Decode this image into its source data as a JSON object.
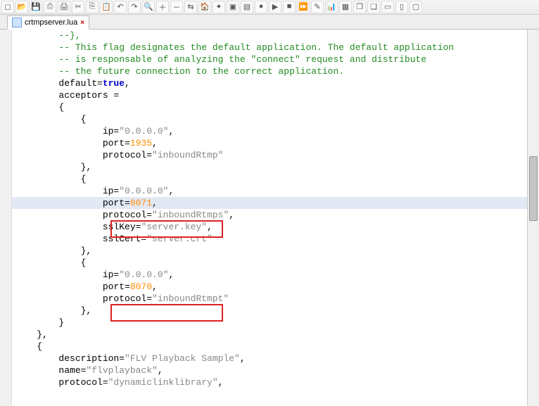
{
  "toolbar_icons": [
    "new",
    "open",
    "save",
    "saveall",
    "sep",
    "cut",
    "copy",
    "paste",
    "sep",
    "undo",
    "redo",
    "search",
    "replace",
    "zoom",
    "zoom-out",
    "home",
    "up",
    "down",
    "list",
    "record",
    "play",
    "stop",
    "forward",
    "eyedrop",
    "chart",
    "box",
    "box2",
    "win",
    "box3",
    "box4"
  ],
  "tab": {
    "filename": "crtmpserver.lua",
    "close_glyph": "×"
  },
  "code": {
    "l1": "        --},",
    "l2a": "        ",
    "l2b": "-- This flag designates the default application. The default application",
    "l3a": "        ",
    "l3b": "-- is responsable of analyzing the \"connect\" request and distribute",
    "l4a": "        ",
    "l4b": "-- the future connection to the correct application.",
    "l5a": "        default=",
    "l5b": "true",
    "l5c": ",",
    "l6": "        acceptors =",
    "l7": "        {",
    "l8": "            {",
    "l9a": "                ip=",
    "l9b": "\"0.0.0.0\"",
    "l9c": ",",
    "l10a": "                port=",
    "l10b": "1935",
    "l10c": ",",
    "l11a": "                protocol=",
    "l11b": "\"inboundRtmp\"",
    "l12": "            },",
    "l13": "            {",
    "l14a": "                ip=",
    "l14b": "\"0.0.0.0\"",
    "l14c": ",",
    "l15a": "                port=",
    "l15b": "8071",
    "l15c": ",",
    "l16a": "                protocol=",
    "l16b": "\"inboundRtmps\"",
    "l16c": ",",
    "l17a": "                sslKey=",
    "l17b": "\"server.key\"",
    "l17c": ",",
    "l18a": "                sslCert=",
    "l18b": "\"server.crt\"",
    "l19": "            },",
    "l20": "            {",
    "l21a": "                ip=",
    "l21b": "\"0.0.0.0\"",
    "l21c": ",",
    "l22a": "                port=",
    "l22b": "8070",
    "l22c": ",",
    "l23a": "                protocol=",
    "l23b": "\"inboundRtmpt\"",
    "l24": "            },",
    "l25": "        }",
    "l26": "    },",
    "l27": "    {",
    "l28a": "        description=",
    "l28b": "\"FLV Playback Sample\"",
    "l28c": ",",
    "l29a": "        name=",
    "l29b": "\"flvplayback\"",
    "l29c": ",",
    "l30a": "        protocol=",
    "l30b": "\"dynamiclinklibrary\"",
    "l30c": ","
  }
}
